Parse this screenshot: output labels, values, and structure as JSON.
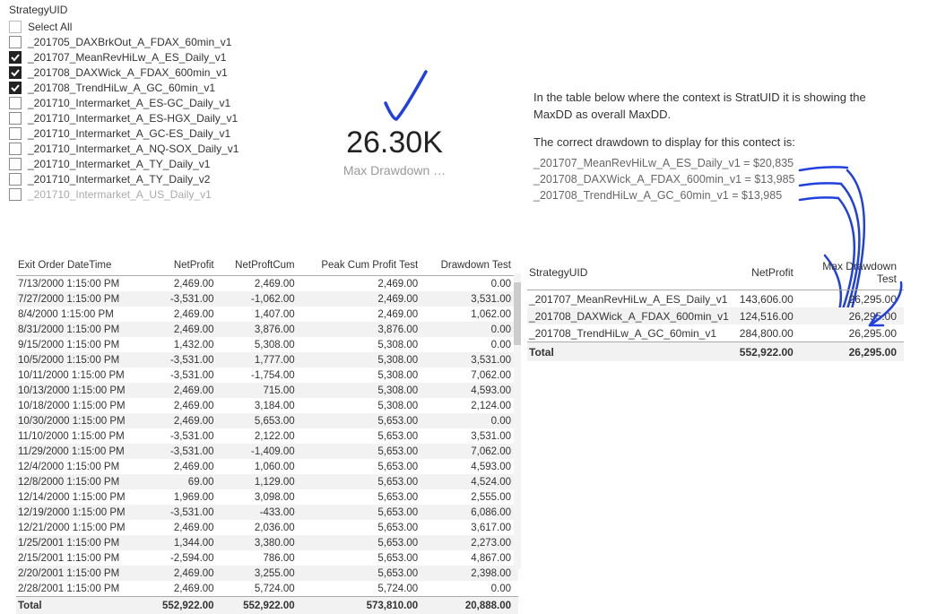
{
  "slicer": {
    "title": "StrategyUID",
    "selectAll": "Select All",
    "items": [
      {
        "label": "_201705_DAXBrkOut_A_FDAX_60min_v1",
        "checked": false
      },
      {
        "label": "_201707_MeanRevHiLw_A_ES_Daily_v1",
        "checked": true
      },
      {
        "label": "_201708_DAXWick_A_FDAX_600min_v1",
        "checked": true
      },
      {
        "label": "_201708_TrendHiLw_A_GC_60min_v1",
        "checked": true
      },
      {
        "label": "_201710_Intermarket_A_ES-GC_Daily_v1",
        "checked": false
      },
      {
        "label": "_201710_Intermarket_A_ES-HGX_Daily_v1",
        "checked": false
      },
      {
        "label": "_201710_Intermarket_A_GC-ES_Daily_v1",
        "checked": false
      },
      {
        "label": "_201710_Intermarket_A_NQ-SOX_Daily_v1",
        "checked": false
      },
      {
        "label": "_201710_Intermarket_A_TY_Daily_v1",
        "checked": false
      },
      {
        "label": "_201710_Intermarket_A_TY_Daily_v2",
        "checked": false
      },
      {
        "label": "_201710_Intermarket_A_US_Daily_v1",
        "checked": false,
        "faded": true
      }
    ]
  },
  "kpi": {
    "value": "26.30K",
    "label": "Max Drawdown …"
  },
  "note": {
    "line1": "In the table below where the context is StratUID it is showing the MaxDD as overall MaxDD.",
    "line2": "The correct drawdown to display for this contect is:",
    "vals": [
      "_201707_MeanRevHiLw_A_ES_Daily_v1 = $20,835",
      "_201708_DAXWick_A_FDAX_600min_v1 = $13,985",
      "_201708_TrendHiLw_A_GC_60min_v1 = $13,985"
    ]
  },
  "leftTable": {
    "headers": [
      "Exit Order DateTime",
      "NetProfit",
      "NetProftCum",
      "Peak Cum Profit Test",
      "Drawdown Test"
    ],
    "rows": [
      [
        "7/13/2000 1:15:00 PM",
        "2,469.00",
        "2,469.00",
        "2,469.00",
        "0.00"
      ],
      [
        "7/27/2000 1:15:00 PM",
        "-3,531.00",
        "-1,062.00",
        "2,469.00",
        "3,531.00"
      ],
      [
        "8/4/2000 1:15:00 PM",
        "2,469.00",
        "1,407.00",
        "2,469.00",
        "1,062.00"
      ],
      [
        "8/31/2000 1:15:00 PM",
        "2,469.00",
        "3,876.00",
        "3,876.00",
        "0.00"
      ],
      [
        "9/15/2000 1:15:00 PM",
        "1,432.00",
        "5,308.00",
        "5,308.00",
        "0.00"
      ],
      [
        "10/5/2000 1:15:00 PM",
        "-3,531.00",
        "1,777.00",
        "5,308.00",
        "3,531.00"
      ],
      [
        "10/11/2000 1:15:00 PM",
        "-3,531.00",
        "-1,754.00",
        "5,308.00",
        "7,062.00"
      ],
      [
        "10/13/2000 1:15:00 PM",
        "2,469.00",
        "715.00",
        "5,308.00",
        "4,593.00"
      ],
      [
        "10/18/2000 1:15:00 PM",
        "2,469.00",
        "3,184.00",
        "5,308.00",
        "2,124.00"
      ],
      [
        "10/30/2000 1:15:00 PM",
        "2,469.00",
        "5,653.00",
        "5,653.00",
        "0.00"
      ],
      [
        "11/10/2000 1:15:00 PM",
        "-3,531.00",
        "2,122.00",
        "5,653.00",
        "3,531.00"
      ],
      [
        "11/29/2000 1:15:00 PM",
        "-3,531.00",
        "-1,409.00",
        "5,653.00",
        "7,062.00"
      ],
      [
        "12/4/2000 1:15:00 PM",
        "2,469.00",
        "1,060.00",
        "5,653.00",
        "4,593.00"
      ],
      [
        "12/8/2000 1:15:00 PM",
        "69.00",
        "1,129.00",
        "5,653.00",
        "4,524.00"
      ],
      [
        "12/14/2000 1:15:00 PM",
        "1,969.00",
        "3,098.00",
        "5,653.00",
        "2,555.00"
      ],
      [
        "12/19/2000 1:15:00 PM",
        "-3,531.00",
        "-433.00",
        "5,653.00",
        "6,086.00"
      ],
      [
        "12/21/2000 1:15:00 PM",
        "2,469.00",
        "2,036.00",
        "5,653.00",
        "3,617.00"
      ],
      [
        "1/25/2001 1:15:00 PM",
        "1,344.00",
        "3,380.00",
        "5,653.00",
        "2,273.00"
      ],
      [
        "2/15/2001 1:15:00 PM",
        "-2,594.00",
        "786.00",
        "5,653.00",
        "4,867.00"
      ],
      [
        "2/20/2001 1:15:00 PM",
        "2,469.00",
        "3,255.00",
        "5,653.00",
        "2,398.00"
      ],
      [
        "2/28/2001 1:15:00 PM",
        "2,469.00",
        "5,724.00",
        "5,724.00",
        "0.00"
      ]
    ],
    "total": [
      "Total",
      "552,922.00",
      "552,922.00",
      "573,810.00",
      "20,888.00"
    ]
  },
  "rightTable": {
    "headers": [
      "StrategyUID",
      "NetProfit",
      "Max Drawdown Test"
    ],
    "rows": [
      [
        "_201707_MeanRevHiLw_A_ES_Daily_v1",
        "143,606.00",
        "26,295.00"
      ],
      [
        "_201708_DAXWick_A_FDAX_600min_v1",
        "124,516.00",
        "26,295.00"
      ],
      [
        "_201708_TrendHiLw_A_GC_60min_v1",
        "284,800.00",
        "26,295.00"
      ]
    ],
    "total": [
      "Total",
      "552,922.00",
      "26,295.00"
    ]
  }
}
